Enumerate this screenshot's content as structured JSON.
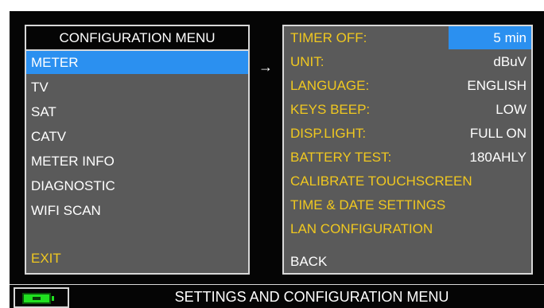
{
  "left_menu": {
    "title": "CONFIGURATION MENU",
    "items": [
      {
        "label": "METER",
        "selected": true
      },
      {
        "label": "TV"
      },
      {
        "label": "SAT"
      },
      {
        "label": "CATV"
      },
      {
        "label": "METER INFO"
      },
      {
        "label": "DIAGNOSTIC"
      },
      {
        "label": "WIFI SCAN"
      }
    ],
    "exit_label": "EXIT"
  },
  "arrow": "→",
  "right_menu": {
    "settings": [
      {
        "label": "TIMER OFF:",
        "value": "5 min",
        "selected": true
      },
      {
        "label": "UNIT:",
        "value": "dBuV"
      },
      {
        "label": "LANGUAGE:",
        "value": "ENGLISH"
      },
      {
        "label": "KEYS BEEP:",
        "value": "LOW"
      },
      {
        "label": "DISP.LIGHT:",
        "value": "FULL ON"
      },
      {
        "label": "BATTERY TEST:",
        "value": "180AHLY"
      }
    ],
    "actions": [
      {
        "label": "CALIBRATE TOUCHSCREEN"
      },
      {
        "label": "TIME & DATE SETTINGS"
      },
      {
        "label": "LAN CONFIGURATION"
      }
    ],
    "back_label": "BACK"
  },
  "status_bar": {
    "text": "SETTINGS AND CONFIGURATION MENU",
    "battery_icon": "battery-icon"
  },
  "colors": {
    "selection": "#2b90f0",
    "label_yellow": "#f0c820",
    "panel_bg": "#5a5a5a",
    "battery_green": "#20e020"
  }
}
